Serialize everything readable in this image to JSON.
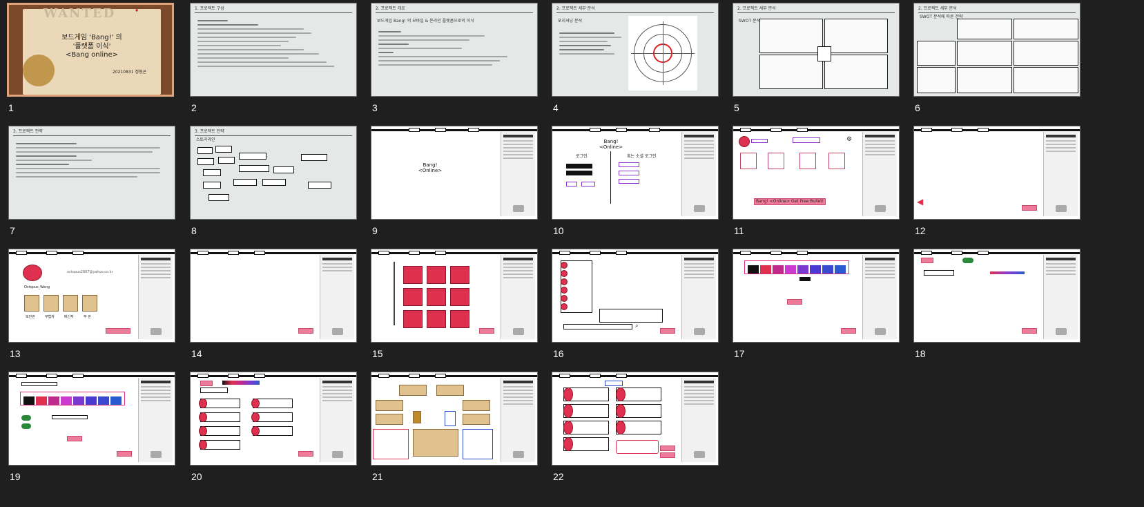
{
  "slides": [
    {
      "num": "1",
      "title": "보드게임 'Bang!' 의\n'플랫폼 이식'\n<Bang online>",
      "author": "20210831 정형곤",
      "stamp": "WANTED"
    },
    {
      "num": "2",
      "header": "1. 프로젝트 구성"
    },
    {
      "num": "3",
      "header": "2. 프로젝트 개요",
      "subtitle": "보드게임 Bang! 의 모바일 & 온라인 플랫폼으로의 이식"
    },
    {
      "num": "4",
      "header": "2. 프로젝트 세부 분석",
      "subtitle": "포지셔닝 분석"
    },
    {
      "num": "5",
      "header": "2. 프로젝트 세부 분석",
      "subtitle": "SWOT 분석"
    },
    {
      "num": "6",
      "header": "2. 프로젝트 세부 분석",
      "subtitle": "SWOT 분석에 따른 전략"
    },
    {
      "num": "7",
      "header": "3. 프로젝트 전략"
    },
    {
      "num": "8",
      "header": "3. 프로젝트 전략",
      "subtitle": "스토리라인"
    },
    {
      "num": "9",
      "title": "Bang!\n<Online>"
    },
    {
      "num": "10",
      "title": "Bang!\n<Online>",
      "left": "로그인",
      "right": "혹는 소셜 로그인"
    },
    {
      "num": "11",
      "bottom": "Bang! <Online> Get Free Bullet!"
    },
    {
      "num": "12"
    },
    {
      "num": "13",
      "user": "Octopus_Wang",
      "email": "octopus2887@yahoo.co.kr",
      "roles": [
        "보안관",
        "무법자",
        "배신자",
        "부 관"
      ]
    },
    {
      "num": "14"
    },
    {
      "num": "15"
    },
    {
      "num": "16"
    },
    {
      "num": "17"
    },
    {
      "num": "18"
    },
    {
      "num": "19"
    },
    {
      "num": "20"
    },
    {
      "num": "21"
    },
    {
      "num": "22"
    }
  ]
}
